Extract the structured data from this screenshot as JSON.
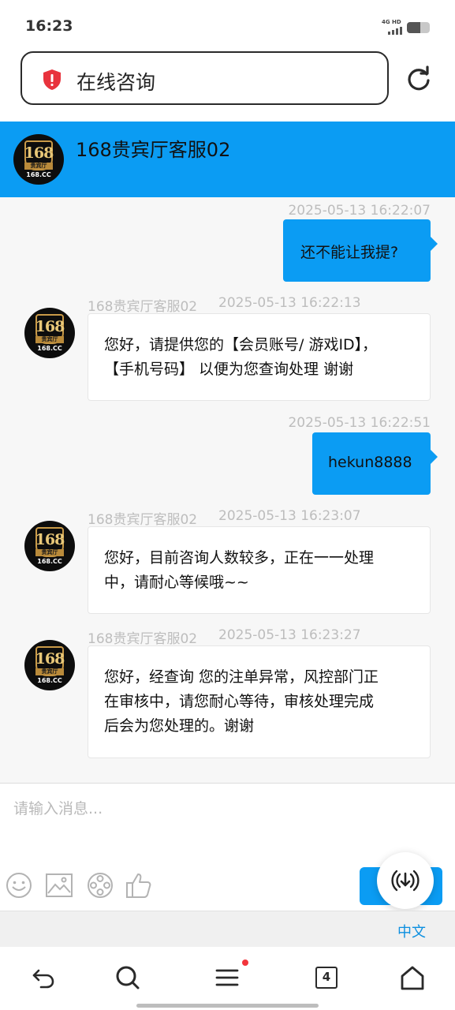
{
  "status": {
    "time": "16:23",
    "network": "4G HD"
  },
  "browser": {
    "address_title": "在线咨询"
  },
  "chat": {
    "agent_name": "168贵宾厅客服02",
    "avatar_text": {
      "number": "168",
      "ribbon": "贵宾厅",
      "domain": "168.CC"
    },
    "messages": [
      {
        "direction": "out",
        "time": "2025-05-13 16:22:07",
        "lines": [
          "还不能让我提?"
        ]
      },
      {
        "direction": "in",
        "sender": "168贵宾厅客服02",
        "time": "2025-05-13 16:22:13",
        "lines": [
          "您好，请提供您的【会员账号/ 游戏ID】，",
          "【手机号码】 以便为您查询处理 谢谢"
        ]
      },
      {
        "direction": "out",
        "time": "2025-05-13 16:22:51",
        "lines": [
          "hekun8888"
        ]
      },
      {
        "direction": "in",
        "sender": "168贵宾厅客服02",
        "time": "2025-05-13 16:23:07",
        "lines": [
          "您好，目前咨询人数较多，正在一一处理",
          "中，请耐心等候哦~~"
        ]
      },
      {
        "direction": "in",
        "sender": "168贵宾厅客服02",
        "time": "2025-05-13 16:23:27",
        "lines": [
          "您好，经查询  您的注单异常，风控部门正",
          "在审核中，请您耐心等待，审核处理完成",
          "后会为您处理的。谢谢"
        ]
      }
    ]
  },
  "composer": {
    "placeholder": "请输入消息..."
  },
  "language": {
    "label": "中文"
  },
  "nav": {
    "tab_count": "4"
  },
  "colors": {
    "accent": "#0b9cf3",
    "background": "#f7f7f7"
  }
}
